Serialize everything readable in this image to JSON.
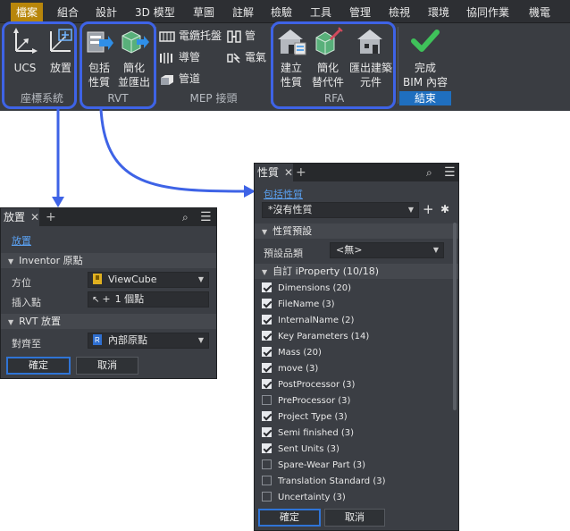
{
  "ribbon": {
    "tabs": [
      "檔案",
      "組合",
      "設計",
      "3D 模型",
      "草圖",
      "註解",
      "檢驗",
      "工具",
      "管理",
      "檢視",
      "環境",
      "協同作業",
      "機電"
    ],
    "active_tab": "檔案",
    "groups": {
      "coord": {
        "label": "座標系統",
        "ucs": "UCS",
        "place": "放置"
      },
      "rvt": {
        "label": "RVT",
        "include": "包括\n性質",
        "simplify": "簡化\n並匯出"
      },
      "mep": {
        "label": "MEP 接頭",
        "cable_tray": "電纜托盤",
        "pipe": "管",
        "conduit": "導管",
        "electrical": "電氣",
        "duct": "管道"
      },
      "rfa": {
        "label": "RFA",
        "create": "建立\n性質",
        "simplify_sub": "簡化\n替代件",
        "export_component": "匯出建築\n元件"
      },
      "finish": {
        "label": "結束",
        "complete": "完成\nBIM 內容"
      }
    }
  },
  "place_panel": {
    "tab": "放置",
    "link": "放置",
    "section_inventor": "Inventor 原點",
    "orientation_label": "方位",
    "orientation_value": "ViewCube",
    "insert_label": "插入點",
    "insert_value": "1 個點",
    "section_rvt": "RVT 放置",
    "align_label": "對齊至",
    "align_value": "內部原點",
    "ok": "確定",
    "cancel": "取消"
  },
  "props_panel": {
    "tab": "性質",
    "link": "包括性質",
    "filter_value": "*沒有性質",
    "section_preset": "性質預設",
    "preset_label": "預設品類",
    "preset_value": "<無>",
    "section_custom": "自訂 iProperty (10/18)",
    "items": [
      {
        "label": "Dimensions (20)",
        "checked": true
      },
      {
        "label": "FileName (3)",
        "checked": true
      },
      {
        "label": "InternalName (2)",
        "checked": true
      },
      {
        "label": "Key Parameters (14)",
        "checked": true
      },
      {
        "label": "Mass (20)",
        "checked": true
      },
      {
        "label": "move (3)",
        "checked": true
      },
      {
        "label": "PostProcessor (3)",
        "checked": true
      },
      {
        "label": "PreProcessor (3)",
        "checked": false
      },
      {
        "label": "Project Type (3)",
        "checked": true
      },
      {
        "label": "Semi finished (3)",
        "checked": true
      },
      {
        "label": "Sent Units (3)",
        "checked": true
      },
      {
        "label": "Spare-Wear Part (3)",
        "checked": false
      },
      {
        "label": "Translation Standard (3)",
        "checked": false
      },
      {
        "label": "Uncertainty (3)",
        "checked": false
      }
    ],
    "ok": "確定",
    "cancel": "取消"
  },
  "colors": {
    "accent": "#3e63e6",
    "ok_border": "#2f74d6",
    "active_tab": "#b8860b",
    "link": "#5aa0f0"
  }
}
